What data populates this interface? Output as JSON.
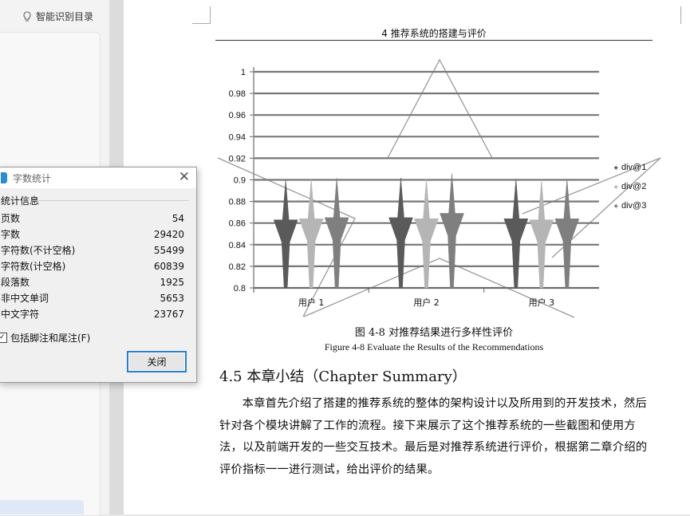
{
  "sidebar": {
    "toc_label": "智能识别目录",
    "toc_icon": "lightbulb-icon"
  },
  "page": {
    "header": "4 推荐系统的搭建与评价",
    "figure_caption_cn": "图 4-8 对推荐结果进行多样性评价",
    "figure_caption_en": "Figure 4-8 Evaluate the Results of the Recommendations",
    "section_title": "4.5 本章小结（Chapter Summary）",
    "body": "本章首先介绍了搭建的推荐系统的整体的架构设计以及所用到的开发技术，然后针对各个模块讲解了工作的流程。接下来展示了这个推荐系统的一些截图和使用方法，以及前端开发的一些交互技术。最后是对推荐系统进行评价，根据第二章介绍的评价指标一一进行测试，给出评价的结果。"
  },
  "dialog": {
    "title": "字数统计",
    "group_title": "统计信息",
    "stats": [
      {
        "label": "页数",
        "value": "54"
      },
      {
        "label": "字数",
        "value": "29420"
      },
      {
        "label": "字符数(不计空格)",
        "value": "55499"
      },
      {
        "label": "字符数(计空格)",
        "value": "60839"
      },
      {
        "label": "段落数",
        "value": "1925"
      },
      {
        "label": "非中文单词",
        "value": "5653"
      },
      {
        "label": "中文字符",
        "value": "23767"
      }
    ],
    "checkbox_label": "包括脚注和尾注(F)",
    "checkbox_checked": true,
    "close_button": "关闭"
  },
  "chart_data": {
    "type": "bar",
    "categories": [
      "用户 1",
      "用户 2",
      "用户 3"
    ],
    "series": [
      {
        "name": "div@1",
        "values": [
          0.863,
          0.865,
          0.864
        ],
        "color": "#5a5a5a"
      },
      {
        "name": "div@2",
        "values": [
          0.864,
          0.864,
          0.863
        ],
        "color": "#b5b5b5"
      },
      {
        "name": "div@3",
        "values": [
          0.865,
          0.869,
          0.864
        ],
        "color": "#7f7f7f"
      }
    ],
    "ylim": [
      0.8,
      1
    ],
    "yticks": [
      "0.8",
      "0.82",
      "0.84",
      "0.86",
      "0.88",
      "0.9",
      "0.92",
      "0.94",
      "0.96",
      "0.98",
      "1"
    ],
    "legend_position": "right",
    "grid": true
  }
}
